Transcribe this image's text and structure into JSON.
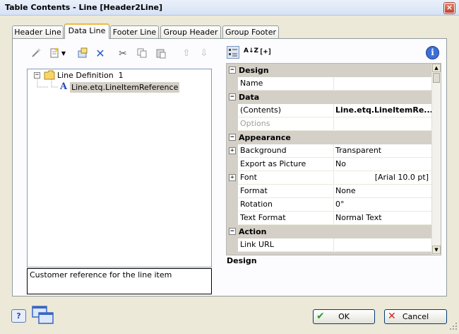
{
  "window": {
    "title": "Table Contents - Line [Header2Line]",
    "close_glyph": "×"
  },
  "tabs": [
    {
      "label": "Header Line"
    },
    {
      "label": "Data Line"
    },
    {
      "label": "Footer Line"
    },
    {
      "label": "Group Header"
    },
    {
      "label": "Group Footer"
    }
  ],
  "tree": {
    "root": {
      "label": "Line Definition  1",
      "expander": "−"
    },
    "child": {
      "label": "Line.etq.LineItemReference",
      "icon_glyph": "A"
    }
  },
  "description": "Customer reference for the line item",
  "properties": {
    "categories": {
      "design": "Design",
      "data": "Data",
      "appearance": "Appearance",
      "action": "Action"
    },
    "rows": {
      "name": {
        "name": "Name",
        "value": ""
      },
      "contents": {
        "name": "(Contents)",
        "value": "Line.etq.LineItemRe..."
      },
      "options": {
        "name": "Options",
        "value": ""
      },
      "background": {
        "name": "Background",
        "value": "Transparent"
      },
      "export_as_picture": {
        "name": "Export as Picture",
        "value": "No"
      },
      "font": {
        "name": "Font",
        "value": "[Arial 10.0 pt]"
      },
      "format": {
        "name": "Format",
        "value": "None"
      },
      "rotation": {
        "name": "Rotation",
        "value": "0°"
      },
      "text_format": {
        "name": "Text Format",
        "value": "Normal Text"
      },
      "link_url": {
        "name": "Link URL",
        "value": ""
      }
    },
    "help_title": "Design",
    "sort_label": "A↓Z",
    "expand_label": "[+]"
  },
  "buttons": {
    "ok": "OK",
    "cancel": "Cancel"
  },
  "colors": {
    "accent_tab": "#f3b83a",
    "category_bg": "#d4d0c8",
    "selection_bg": "#d4d0c8"
  }
}
